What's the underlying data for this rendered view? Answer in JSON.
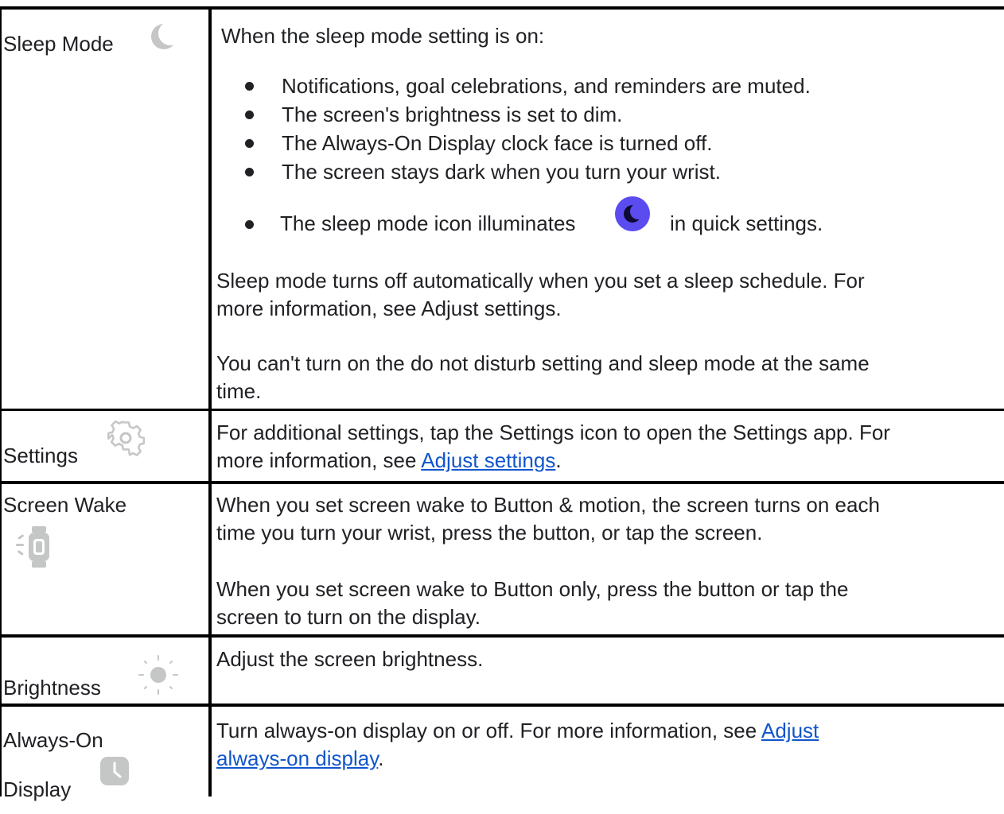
{
  "rows": {
    "sleep_mode": {
      "label": "Sleep Mode",
      "icon": "crescent-moon-icon",
      "intro": "When the sleep mode setting is on:",
      "bullets": [
        "Notifications, goal celebrations, and reminders are muted.",
        "The screen's brightness is set to dim.",
        "The Always-On Display clock face is turned off.",
        "The screen stays dark when you turn your wrist."
      ],
      "bullet5_before": "The sleep mode icon illuminates",
      "bullet5_after": "in quick settings.",
      "bullet5_icon": "sleep-mode-quick-setting-icon",
      "para1_line1": "Sleep mode turns off automatically when you set a sleep schedule. For",
      "para1_line2": "more information, see Adjust settings.",
      "para2_line1": "You can't turn on the do not disturb setting and sleep mode at the same",
      "para2_line2": "time."
    },
    "settings": {
      "label": "Settings",
      "icon": "gear-icon",
      "line1": "For additional settings, tap the Settings icon to open the Settings app. For",
      "line2_before": "more information, see ",
      "link": "Adjust settings",
      "line2_after": "."
    },
    "screen_wake": {
      "label": "Screen Wake",
      "icon": "watch-wake-icon",
      "para1_line1": "When you set screen wake to Button & motion, the screen turns on each",
      "para1_line2": "time you turn your wrist, press the button, or tap the screen.",
      "para2_line1": "When you set screen wake to Button only, press the button or tap the",
      "para2_line2": "screen to turn on the display."
    },
    "brightness": {
      "label": "Brightness",
      "icon": "sun-icon",
      "text": "Adjust the screen brightness."
    },
    "always_on": {
      "label_line1": "Always-On",
      "label_line2": "Display",
      "icon": "clock-icon",
      "line1_before": "Turn always-on display on or off. For more information, see ",
      "link_line1": "Adjust",
      "link_line2": "always-on display",
      "line2_after": "."
    }
  },
  "colors": {
    "text": "#202124",
    "link": "#1155cc",
    "border": "#000000",
    "icon_gray": "#c4c7c5",
    "accent_purple": "#5b4cf0"
  }
}
